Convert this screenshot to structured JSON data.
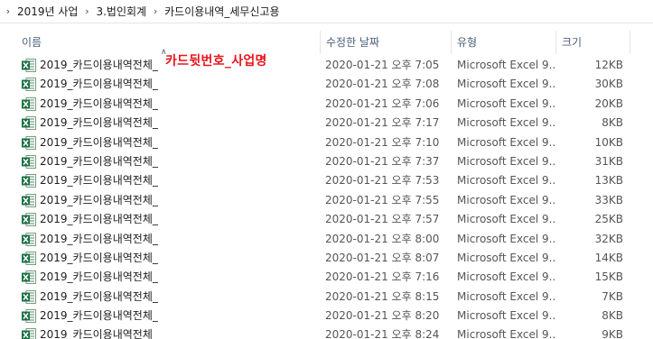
{
  "breadcrumb": [
    "2019년 사업",
    "3.법인회계",
    "카드이용내역_세무신고용"
  ],
  "columns": {
    "name": "이름",
    "date": "수정한 날짜",
    "type": "유형",
    "size": "크기"
  },
  "annotation": "카드뒷번호_사업명",
  "files": [
    {
      "name": "2019_카드이용내역전체_",
      "date": "2020-01-21 오후 7:05",
      "type": "Microsoft Excel 9...",
      "size": "12KB"
    },
    {
      "name": "2019_카드이용내역전체_",
      "date": "2020-01-21 오후 7:08",
      "type": "Microsoft Excel 9...",
      "size": "30KB"
    },
    {
      "name": "2019_카드이용내역전체_",
      "date": "2020-01-21 오후 7:06",
      "type": "Microsoft Excel 9...",
      "size": "20KB"
    },
    {
      "name": "2019_카드이용내역전체_",
      "date": "2020-01-21 오후 7:17",
      "type": "Microsoft Excel 9...",
      "size": "8KB"
    },
    {
      "name": "2019_카드이용내역전체_",
      "date": "2020-01-21 오후 7:10",
      "type": "Microsoft Excel 9...",
      "size": "10KB"
    },
    {
      "name": "2019_카드이용내역전체_",
      "date": "2020-01-21 오후 7:37",
      "type": "Microsoft Excel 9...",
      "size": "31KB"
    },
    {
      "name": "2019_카드이용내역전체_",
      "date": "2020-01-21 오후 7:53",
      "type": "Microsoft Excel 9...",
      "size": "13KB"
    },
    {
      "name": "2019_카드이용내역전체_",
      "date": "2020-01-21 오후 7:55",
      "type": "Microsoft Excel 9...",
      "size": "33KB"
    },
    {
      "name": "2019_카드이용내역전체_",
      "date": "2020-01-21 오후 7:57",
      "type": "Microsoft Excel 9...",
      "size": "25KB"
    },
    {
      "name": "2019_카드이용내역전체_",
      "date": "2020-01-21 오후 8:00",
      "type": "Microsoft Excel 9...",
      "size": "32KB"
    },
    {
      "name": "2019_카드이용내역전체_",
      "date": "2020-01-21 오후 8:07",
      "type": "Microsoft Excel 9...",
      "size": "14KB"
    },
    {
      "name": "2019_카드이용내역전체_",
      "date": "2020-01-21 오후 7:16",
      "type": "Microsoft Excel 9...",
      "size": "15KB"
    },
    {
      "name": "2019_카드이용내역전체_",
      "date": "2020-01-21 오후 8:15",
      "type": "Microsoft Excel 9...",
      "size": "7KB"
    },
    {
      "name": "2019_카드이용내역전체_",
      "date": "2020-01-21 오후 8:20",
      "type": "Microsoft Excel 9...",
      "size": "8KB"
    },
    {
      "name": "2019_카드이용내역전체_",
      "date": "2020-01-21 오후 8:24",
      "type": "Microsoft Excel 9...",
      "size": "9KB"
    }
  ],
  "icons": {
    "file": "excel-file-icon",
    "separator": "chevron-right-icon",
    "sort": "sort-ascending-icon"
  },
  "colors": {
    "annotation": "#e8141c",
    "excel_green": "#1d7044",
    "header_text": "#4c607a"
  }
}
